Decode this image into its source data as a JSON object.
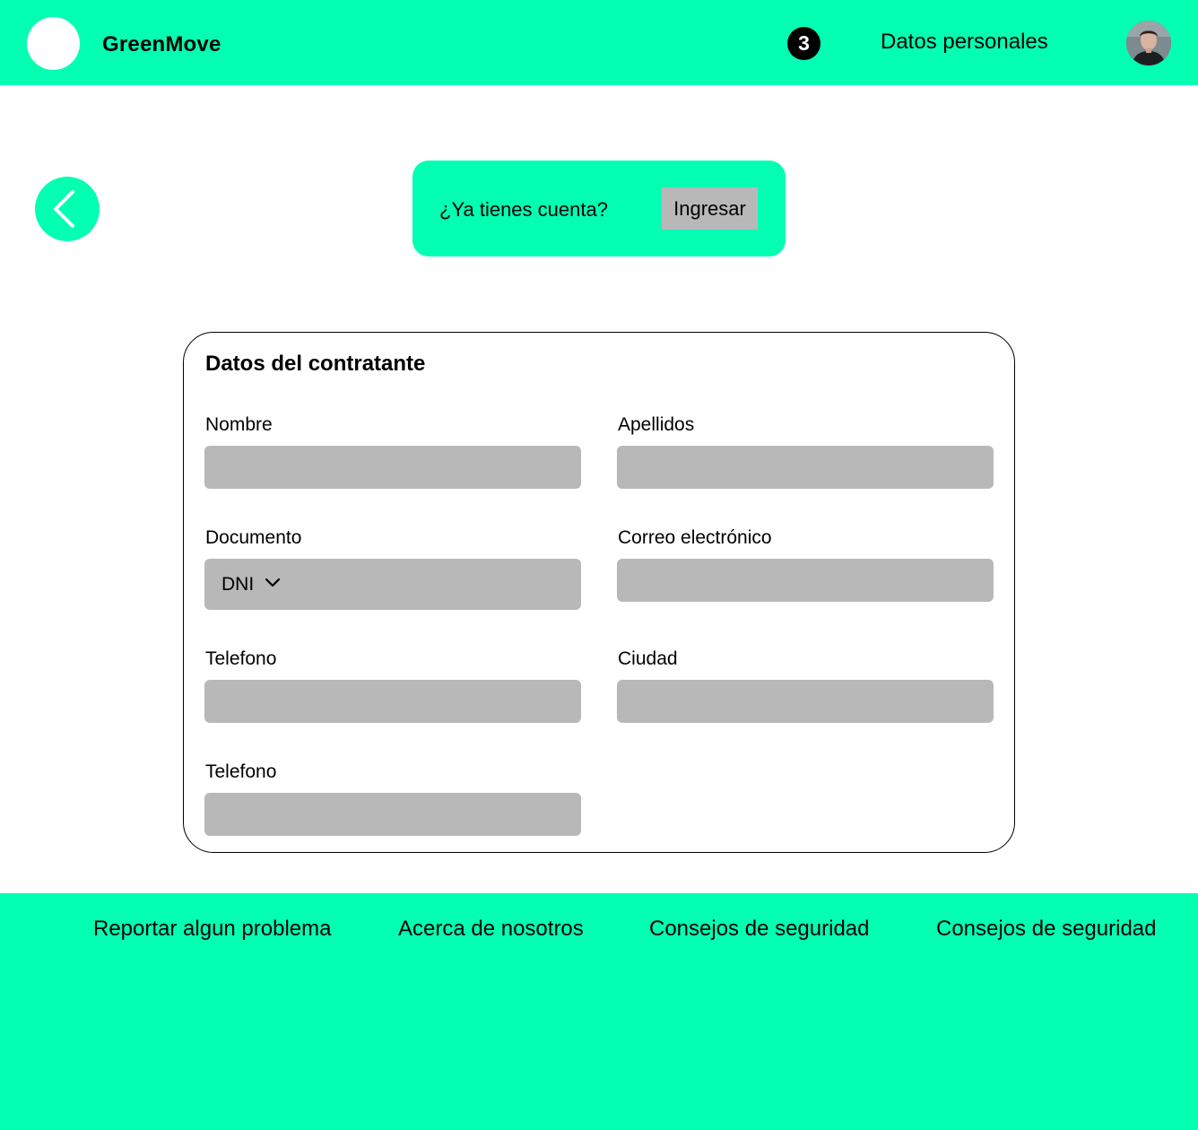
{
  "header": {
    "brand": "GreenMove",
    "step_number": "3",
    "title": "Datos personales"
  },
  "login_banner": {
    "question": "¿Ya tienes cuenta?",
    "button_label": "Ingresar"
  },
  "form": {
    "title": "Datos del contratante",
    "fields": {
      "nombre": {
        "label": "Nombre",
        "value": ""
      },
      "apellidos": {
        "label": "Apellidos",
        "value": ""
      },
      "documento": {
        "label": "Documento",
        "selected": "DNI"
      },
      "correo": {
        "label": "Correo electrónico",
        "value": ""
      },
      "telefono": {
        "label": "Telefono",
        "value": ""
      },
      "ciudad": {
        "label": "Ciudad",
        "value": ""
      },
      "telefono2": {
        "label": "Telefono",
        "value": ""
      }
    }
  },
  "footer": {
    "links": [
      "Reportar algun problema",
      "Acerca de nosotros",
      "Consejos de seguridad",
      "Consejos de seguridad"
    ]
  },
  "icons": {
    "back": "chevron-left-icon",
    "dropdown": "chevron-down-icon",
    "profile": "avatar"
  },
  "colors": {
    "accent": "#02ffb2",
    "input_fill": "#b8b8b8",
    "text": "#000000",
    "background": "#ffffff"
  }
}
